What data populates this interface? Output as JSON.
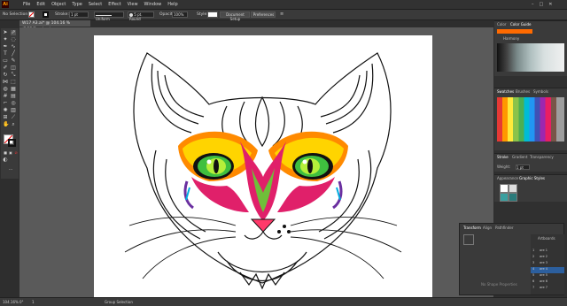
{
  "app": {
    "logo": "Ai"
  },
  "menu": [
    "File",
    "Edit",
    "Object",
    "Type",
    "Select",
    "Effect",
    "View",
    "Window",
    "Help"
  ],
  "control": {
    "selection_label": "No Selection",
    "stroke_label": "Stroke:",
    "stroke_weight": "1 pt",
    "uniform_label": "Uniform",
    "brush_label": "5 pt. Round",
    "opacity_label": "Opacity:",
    "opacity_value": "100%",
    "style_label": "Style:",
    "document_setup": "Document Setup",
    "preferences": "Preferences"
  },
  "document_tab": {
    "title": "W17 A3.ai* @ 104.16 % (RGB/Preview)"
  },
  "panels": {
    "color_tabs": [
      "Color",
      "Color Guide"
    ],
    "harmony_label": "Harmony",
    "swatches_tabs": [
      "Swatches",
      "Brushes",
      "Symbols"
    ],
    "stroke_tabs": [
      "Stroke",
      "Gradient",
      "Transparency"
    ],
    "weight_label": "Weight:",
    "weight_value": "1 pt",
    "appearance_tabs": [
      "Appearance",
      "Graphic Styles"
    ]
  },
  "transform_panel": {
    "tabs": [
      "Transform",
      "Align",
      "Pathfinder"
    ],
    "empty_state": "No Shape Properties",
    "artboards_title": "Artboards",
    "artboards": [
      "are 1",
      "are 2",
      "are 3",
      "are 4",
      "are 5",
      "are 6",
      "are 7"
    ],
    "artboard_nums": [
      "1",
      "2",
      "3",
      "4",
      "5",
      "6",
      "7"
    ]
  },
  "status": {
    "zoom": "104.16%",
    "angle": "0°",
    "artboard": "1",
    "tool": "Group Selection"
  },
  "colors": {
    "accent": "#ff9a00",
    "eye_green": "#3fbf3f",
    "magenta": "#e0206a",
    "orange": "#ff8a00",
    "yellow": "#ffd400",
    "purple": "#6a2fa0",
    "cyan": "#00aee0"
  }
}
